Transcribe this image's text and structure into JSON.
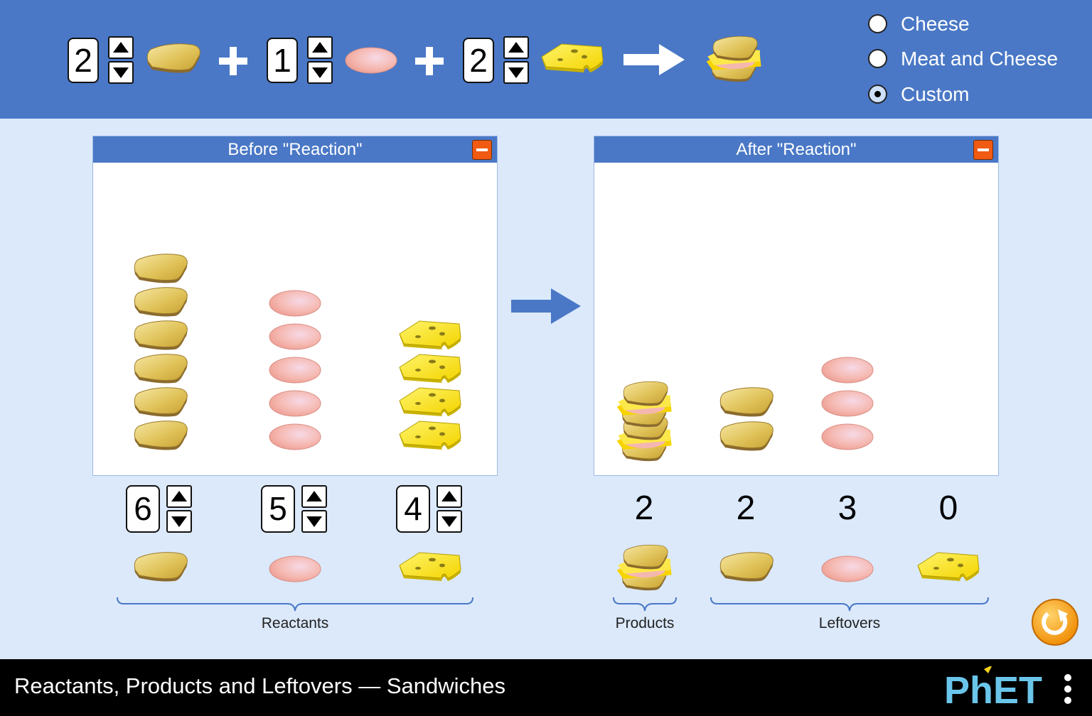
{
  "equation": {
    "bread_coefficient": "2",
    "meat_coefficient": "1",
    "cheese_coefficient": "2",
    "plus_symbol": "+"
  },
  "sandwich_type": {
    "options": [
      {
        "label": "Cheese",
        "selected": false
      },
      {
        "label": "Meat and Cheese",
        "selected": false
      },
      {
        "label": "Custom",
        "selected": true
      }
    ]
  },
  "before_panel": {
    "title": "Before \"Reaction\""
  },
  "after_panel": {
    "title": "After \"Reaction\""
  },
  "reactants": {
    "bread_count": "6",
    "meat_count": "5",
    "cheese_count": "4",
    "label": "Reactants"
  },
  "products": {
    "sandwich_count": "2",
    "label": "Products"
  },
  "leftovers": {
    "bread_count": "2",
    "meat_count": "3",
    "cheese_count": "0",
    "label": "Leftovers"
  },
  "footer": {
    "title": "Reactants, Products and Leftovers — Sandwiches",
    "logo_text": "PhET"
  },
  "colors": {
    "header_blue": "#4a78c6",
    "background": "#dbe9fb",
    "collapse_orange": "#f05a12",
    "reset_orange": "#f7a21b"
  }
}
